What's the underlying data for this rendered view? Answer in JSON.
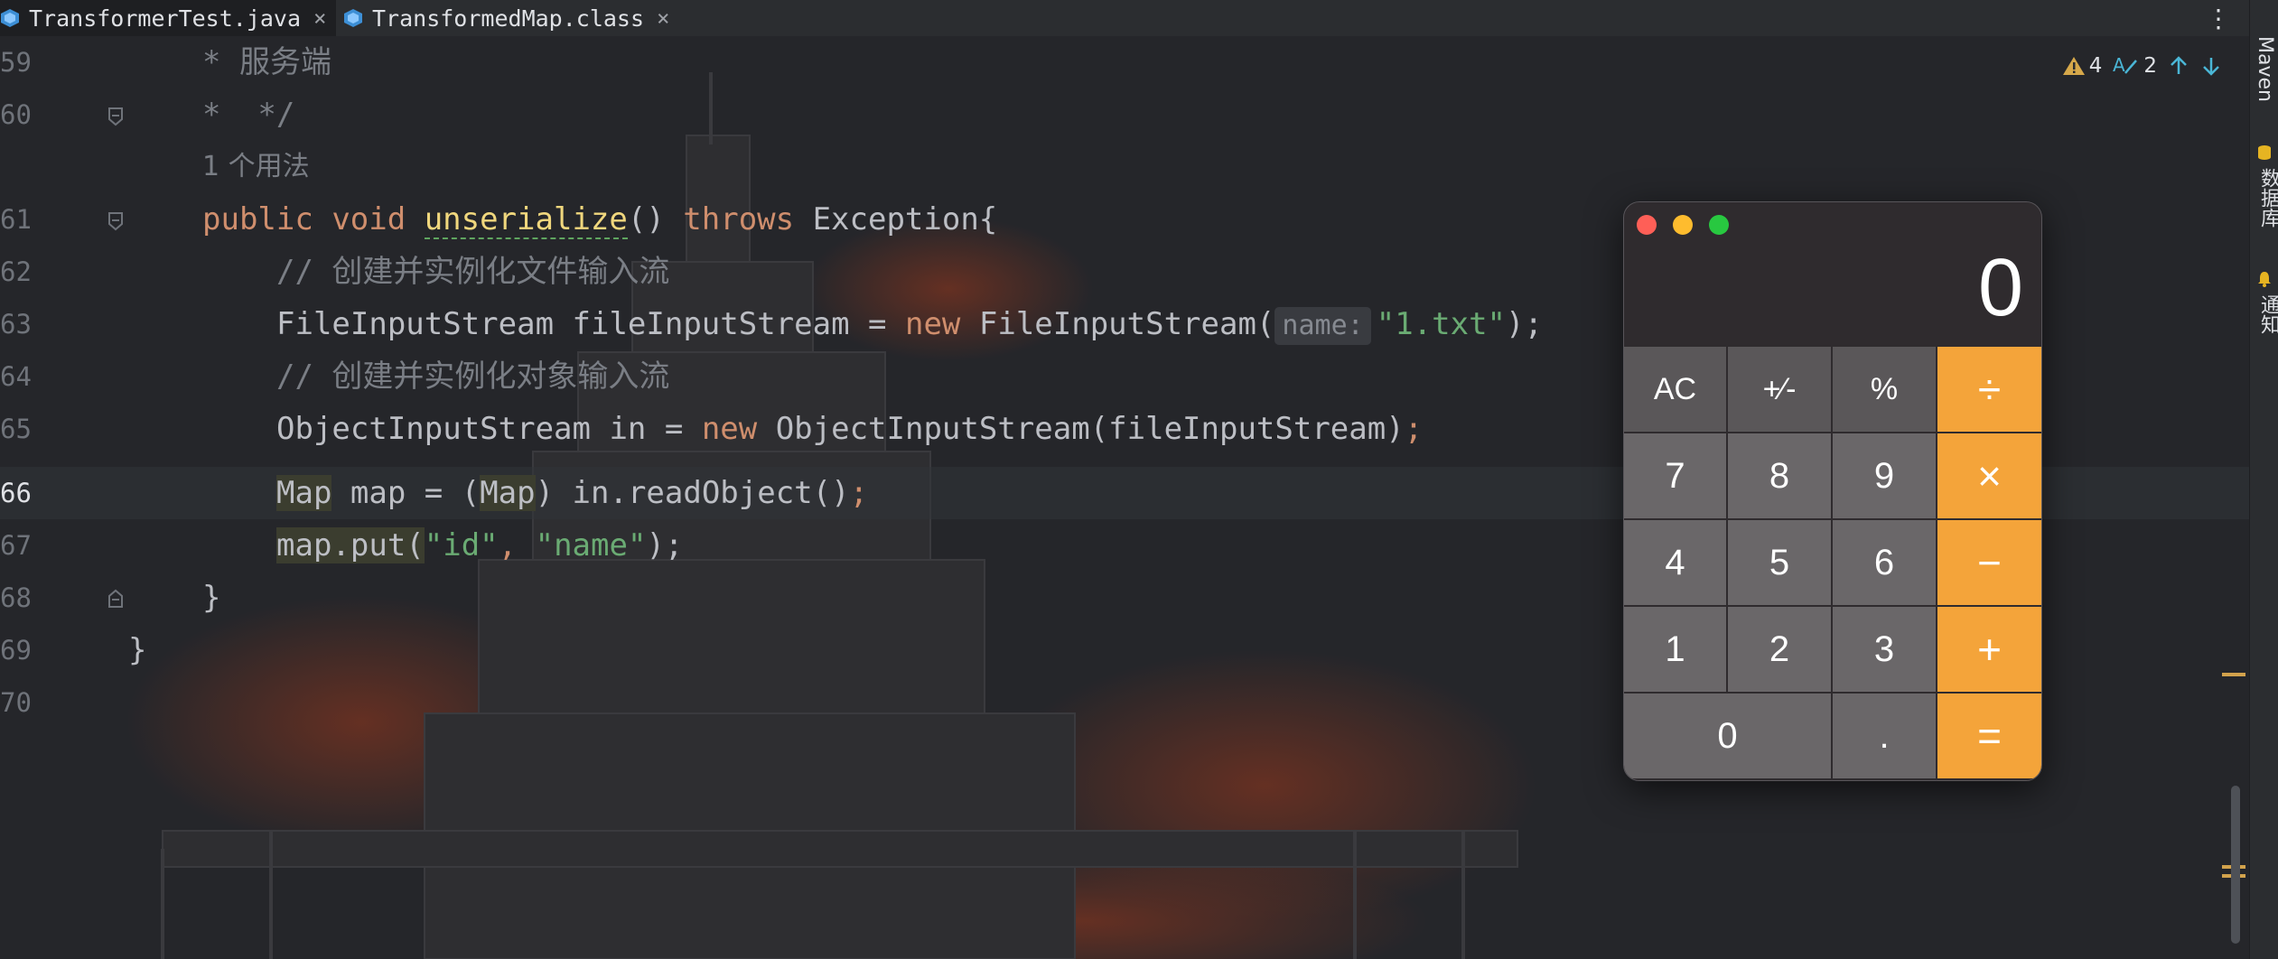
{
  "tabs": [
    {
      "label": "TransformerTest.java",
      "active": true
    },
    {
      "label": "TransformedMap.class",
      "active": false
    }
  ],
  "inspection": {
    "warnings": "4",
    "typos": "2"
  },
  "gutter": {
    "lines": [
      "59",
      "60",
      "",
      "61",
      "62",
      "63",
      "64",
      "65",
      "66",
      "67",
      "68",
      "69",
      "70"
    ]
  },
  "code": {
    "l59": "* 服务端",
    "l60": "*  */",
    "usage": "1 个用法",
    "l61_kw1": "public",
    "l61_kw2": "void",
    "l61_fn": "unserialize",
    "l61_mid": "() ",
    "l61_kw3": "throws",
    "l61_rest": " Exception{",
    "l62": "// 创建并实例化文件输入流",
    "l63_a": "FileInputStream fileInputStream = ",
    "l63_new": "new",
    "l63_b": " FileInputStream(",
    "l63_hint": "name:",
    "l63_str": "\"1.txt\"",
    "l63_end": ");",
    "l64": "// 创建并实例化对象输入流",
    "l65_a": "ObjectInputStream in = ",
    "l65_new": "new",
    "l65_b": " ObjectInputStream(fileInputStream)",
    "l65_end": ";",
    "l66_map": "Map",
    "l66_a": " map = (",
    "l66_map2": "Map",
    "l66_b": ") in.readObject()",
    "l66_end": ";",
    "l67_a": "map.put(",
    "l67_s1": "\"id\"",
    "l67_comma": ", ",
    "l67_s2": "\"name\"",
    "l67_end": ");",
    "l68": "}",
    "l69": "}"
  },
  "right_strip": {
    "maven": "Maven",
    "database": "数据库",
    "notifications": "通知"
  },
  "calculator": {
    "display": "0",
    "keys": [
      "AC",
      "+⁄-",
      "%",
      "÷",
      "7",
      "8",
      "9",
      "×",
      "4",
      "5",
      "6",
      "−",
      "1",
      "2",
      "3",
      "+",
      "0",
      ".",
      "="
    ]
  },
  "colors": {
    "accent_orange": "#f4a43a",
    "editor_bg": "#25262a",
    "keyword": "#cf8e6d",
    "string": "#6aab73"
  }
}
